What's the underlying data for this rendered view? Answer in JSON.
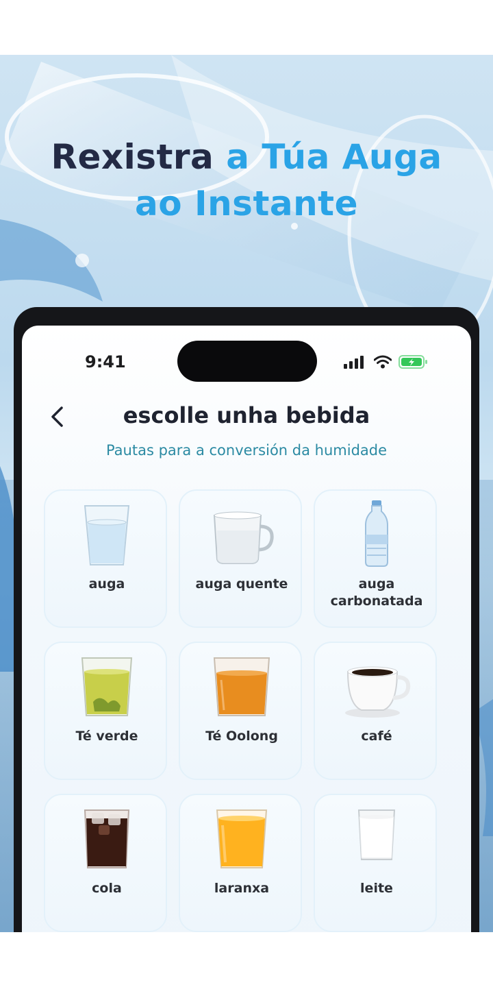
{
  "headline": {
    "line1_dark": "Rexistra",
    "line1_blue": "a Túa Auga",
    "line2_blue": "ao Instante"
  },
  "status_bar": {
    "time": "9:41",
    "icons": [
      "signal-icon",
      "wifi-icon",
      "battery-charging-icon"
    ],
    "battery_color": "#34c759"
  },
  "nav": {
    "back_icon": "chevron-left-icon",
    "title": "escolle unha bebida",
    "subtitle_link": "Pautas para a conversión da humidade"
  },
  "drinks": [
    {
      "label": "auga",
      "icon": "water-glass-icon"
    },
    {
      "label": "auga quente",
      "icon": "glass-mug-icon"
    },
    {
      "label": "auga carbonatada",
      "icon": "water-bottle-icon"
    },
    {
      "label": "Té verde",
      "icon": "green-tea-glass-icon"
    },
    {
      "label": "Té Oolong",
      "icon": "oolong-tea-glass-icon"
    },
    {
      "label": "café",
      "icon": "coffee-cup-icon"
    },
    {
      "label": "cola",
      "icon": "cola-glass-icon"
    },
    {
      "label": "laranxa",
      "icon": "orange-juice-glass-icon"
    },
    {
      "label": "leite",
      "icon": "milk-glass-icon"
    }
  ],
  "colors": {
    "accent": "#2aa3e6",
    "headline_dark": "#232a45",
    "link": "#2b8aa3"
  }
}
